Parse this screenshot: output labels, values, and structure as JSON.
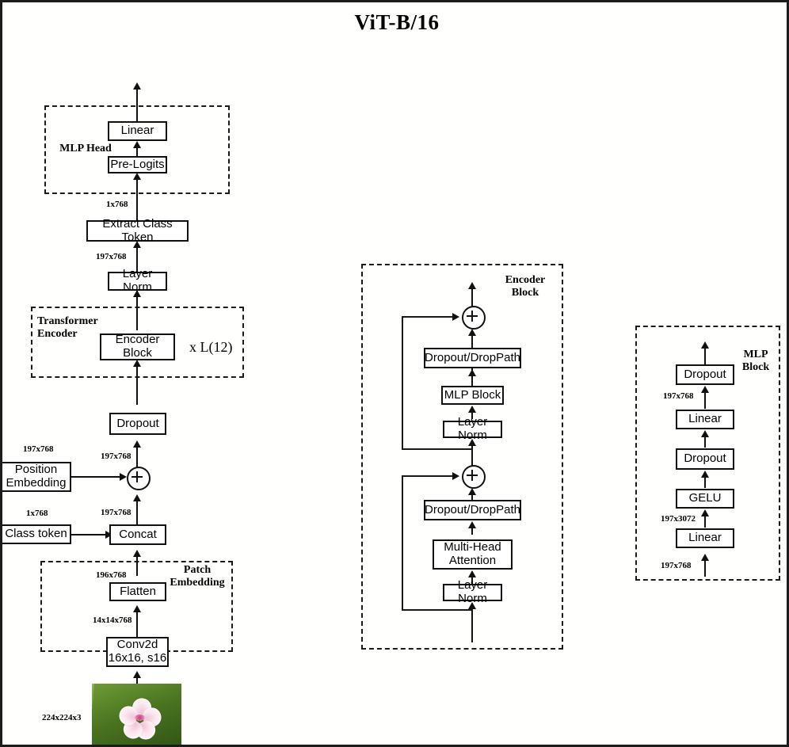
{
  "title": "ViT-B/16",
  "groups": {
    "mlp_head": {
      "label": "MLP Head"
    },
    "transformer_encoder": {
      "label": "Transformer\nEncoder",
      "repeat": "x L(12)"
    },
    "patch_embedding": {
      "label": "Patch\nEmbedding"
    },
    "encoder_block": {
      "label": "Encoder\nBlock"
    },
    "mlp_block": {
      "label": "MLP\nBlock"
    }
  },
  "main_column": {
    "linear": "Linear",
    "pre_logits": "Pre-Logits",
    "extract_class_token": "Extract Class Token",
    "layer_norm": "Layer Norm",
    "encoder_block": "Encoder Block",
    "dropout": "Dropout",
    "position_embedding": "Position\nEmbedding",
    "class_token": "Class token",
    "concat": "Concat",
    "flatten": "Flatten",
    "conv2d": "Conv2d\n16x16, s16",
    "add_symbol": "+"
  },
  "encoder_block_column": {
    "dropout_droppath_top": "Dropout/DropPath",
    "mlp_block": "MLP Block",
    "layer_norm_top": "Layer Norm",
    "dropout_droppath_bottom": "Dropout/DropPath",
    "multi_head_attention": "Multi-Head\nAttention",
    "layer_norm_bottom": "Layer Norm",
    "add_symbol": "+"
  },
  "mlp_block_column": {
    "dropout_top": "Dropout",
    "linear_top": "Linear",
    "dropout_bottom": "Dropout",
    "gelu": "GELU",
    "linear_bottom": "Linear"
  },
  "dimensions": {
    "mlp_head_in": "1x768",
    "extract_in": "197x768",
    "pos_embed_shape": "197x768",
    "add_out": "197x768",
    "class_token_shape": "1x768",
    "concat_out": "197x768",
    "flatten_in": "196x768",
    "conv_out": "14x14x768",
    "image_shape": "224x224x3",
    "mlp_linear_out": "197x768",
    "mlp_gelu_in": "197x3072",
    "mlp_block_in": "197x768"
  },
  "input_image": {
    "alt": "flower-photo",
    "subject": "pink and white flower in green grass"
  },
  "colors": {
    "stroke": "#111111",
    "background": "#fffffd",
    "frame": "#1c1c1c"
  }
}
